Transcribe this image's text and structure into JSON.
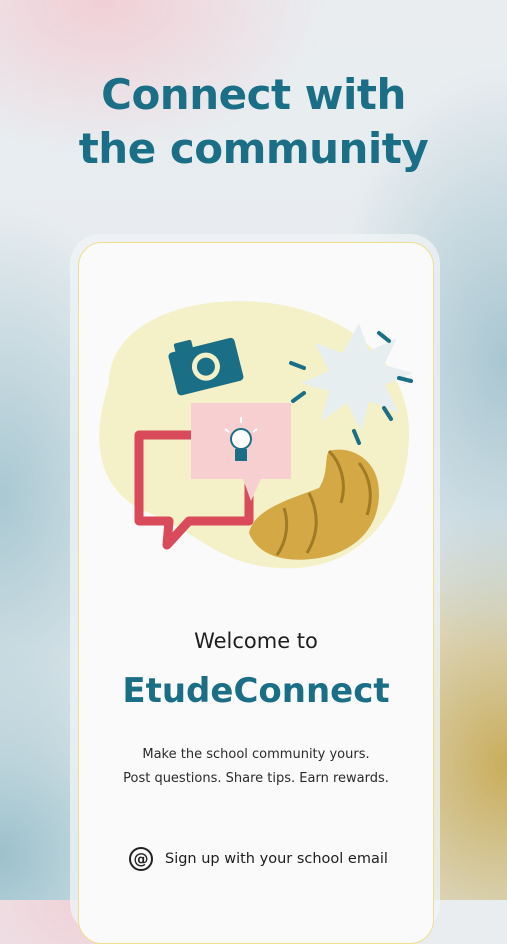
{
  "headline": {
    "line1": "Connect with",
    "line2": "the community"
  },
  "onboarding": {
    "welcome": "Welcome to",
    "app_name": "EtudeConnect",
    "tagline_line1": "Make the school community yours.",
    "tagline_line2": "Post questions. Share tips. Earn rewards.",
    "signup_label": "Sign up with your school email",
    "signup_icon": "at-icon"
  },
  "colors": {
    "brand": "#1a6f86",
    "frame_border": "#f0de8c",
    "chat_bubble": "#d94a5a",
    "croissant": "#d4a845"
  }
}
